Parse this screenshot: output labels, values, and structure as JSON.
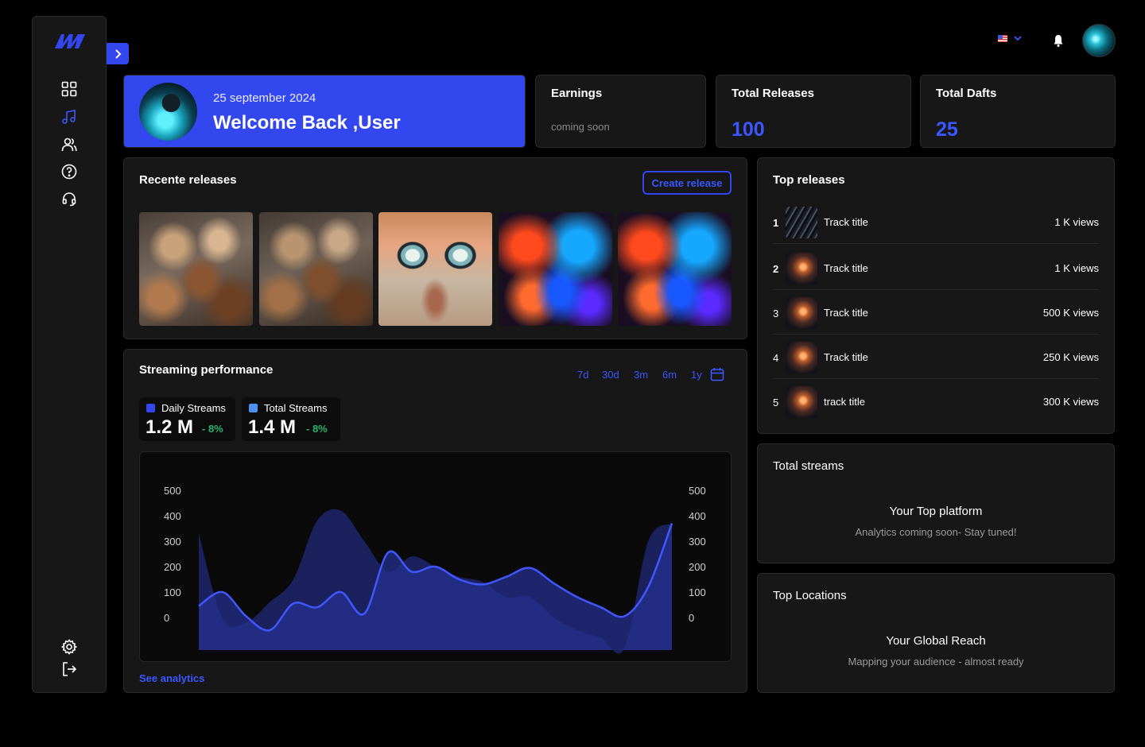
{
  "brand": {
    "accent": "#3347ef",
    "link": "#3b57ff",
    "positive": "#27b36c",
    "logo_icon": "m-logo-icon"
  },
  "sidebar": {
    "items": [
      {
        "icon": "dashboard-icon"
      },
      {
        "icon": "music-note-icon",
        "active": true
      },
      {
        "icon": "users-icon"
      },
      {
        "icon": "help-icon"
      },
      {
        "icon": "headset-icon"
      }
    ],
    "bottom": [
      {
        "icon": "settings-icon"
      },
      {
        "icon": "logout-icon"
      }
    ],
    "expand_icon": "chevron-right-icon"
  },
  "topbar": {
    "language_icon": "us-flag-icon",
    "dropdown_icon": "chevron-down-icon",
    "bell_icon": "bell-icon"
  },
  "welcome": {
    "date": "25 september 2024",
    "greeting": "Welcome Back ,User"
  },
  "stats": {
    "earnings": {
      "title": "Earnings",
      "note": "coming soon"
    },
    "total_releases": {
      "title": "Total Releases",
      "value": "100"
    },
    "total_drafts": {
      "title": "Total Dafts",
      "value": "25"
    }
  },
  "recent_releases": {
    "title": "Recente releases",
    "create_label": "Create release",
    "covers": [
      "baroque-fresco",
      "baroque-fresco",
      "painted-face",
      "color-smoke",
      "color-smoke"
    ]
  },
  "streaming": {
    "title": "Streaming performance",
    "periods": [
      "7d",
      "30d",
      "3m",
      "6m",
      "1y"
    ],
    "calendar_icon": "calendar-icon",
    "daily": {
      "label": "Daily Streams",
      "value": "1.2 M",
      "change": "- 8%",
      "color": "#3347ef"
    },
    "total": {
      "label": "Total Streams",
      "value": "1.4 M",
      "change": "- 8%",
      "color": "#4a90f0"
    },
    "see_link": "See analytics"
  },
  "chart_data": {
    "type": "area",
    "x": [
      0,
      1,
      2,
      3,
      4,
      5,
      6,
      7,
      8,
      9,
      10,
      11,
      12,
      13,
      14,
      15,
      16,
      17,
      18,
      19,
      20
    ],
    "yticks_left": [
      "500",
      "400",
      "300",
      "200",
      "100",
      "0"
    ],
    "yticks_right": [
      "500",
      "400",
      "300",
      "200",
      "100",
      "0"
    ],
    "ylim": [
      -130,
      520
    ],
    "series": [
      {
        "values": [
          330,
          -5,
          -20,
          60,
          150,
          380,
          420,
          300,
          180,
          240,
          200,
          160,
          140,
          80,
          80,
          0,
          -50,
          -80,
          -120,
          300,
          370
        ],
        "color": "#1b2362"
      },
      {
        "values": [
          45,
          100,
          5,
          -50,
          55,
          40,
          100,
          15,
          255,
          180,
          200,
          150,
          130,
          160,
          195,
          135,
          80,
          40,
          5,
          120,
          370
        ],
        "color": "#3347ef"
      }
    ],
    "grid": false,
    "legend": "none"
  },
  "top_releases": {
    "title": "Top releases",
    "rows": [
      {
        "rank": "1",
        "title": "Track title",
        "views": "1 K views"
      },
      {
        "rank": "2",
        "title": "Track title",
        "views": "1 K views"
      },
      {
        "rank": "3",
        "title": "Track title",
        "views": "500 K views"
      },
      {
        "rank": "4",
        "title": "Track title",
        "views": "250 K views"
      },
      {
        "rank": "5",
        "title": "track title",
        "views": "300 K views"
      }
    ]
  },
  "total_streams": {
    "title": "Total streams",
    "heading": "Your Top platform",
    "note": "Analytics coming soon- Stay tuned!"
  },
  "top_locations": {
    "title": "Top Locations",
    "heading": "Your Global Reach",
    "note": "Mapping your audience - almost ready"
  }
}
